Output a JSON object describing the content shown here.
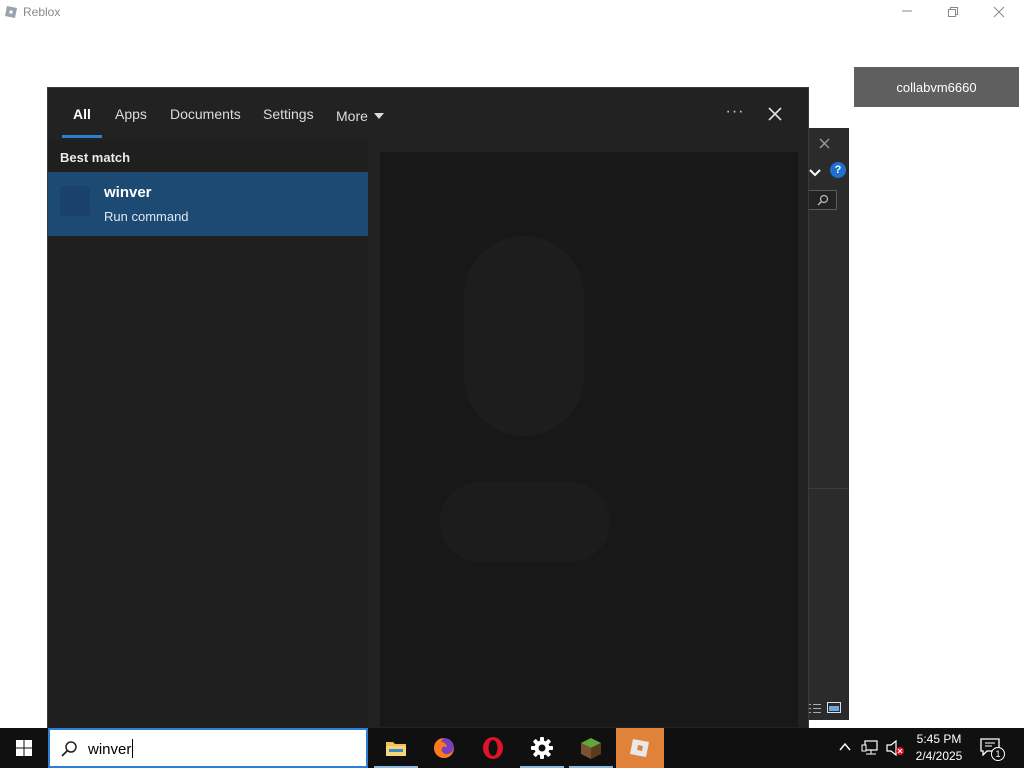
{
  "background_window": {
    "app_name": "Reblox",
    "user_badge": "collabvm6660"
  },
  "search_panel": {
    "tabs": [
      {
        "label": "All",
        "active": true
      },
      {
        "label": "Apps"
      },
      {
        "label": "Documents"
      },
      {
        "label": "Settings"
      },
      {
        "label": "More"
      }
    ],
    "ellipsis_label": "···",
    "best_match_label": "Best match",
    "result": {
      "title": "winver",
      "subtitle": "Run command"
    }
  },
  "behind_window": {
    "help_label": "?"
  },
  "taskbar": {
    "search_value": "winver",
    "pinned_apps": [
      {
        "name": "file-explorer-icon"
      },
      {
        "name": "firefox-icon"
      },
      {
        "name": "opera-icon"
      },
      {
        "name": "settings-icon"
      },
      {
        "name": "minecraft-icon"
      },
      {
        "name": "roblox-icon",
        "active": true
      }
    ],
    "clock": {
      "time": "5:45 PM",
      "date": "2/4/2025"
    },
    "notification_count": "1"
  },
  "colors": {
    "accent": "#2d7fd2",
    "result_highlight": "#1c4a73",
    "roblox_active": "#e1823a",
    "badge_bg": "#5f5f5f"
  }
}
